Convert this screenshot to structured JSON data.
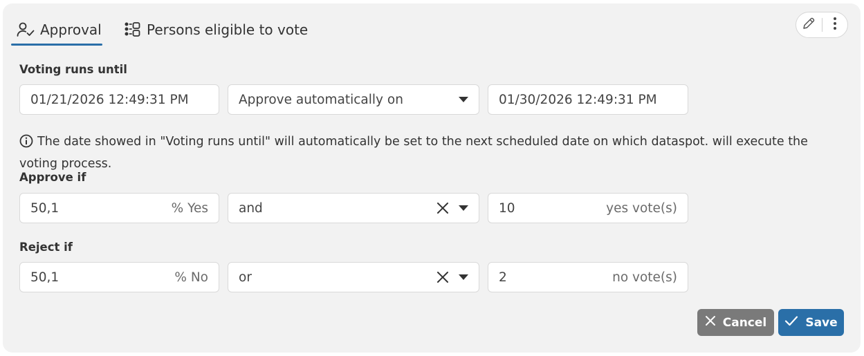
{
  "tabs": {
    "approval_label": "Approval",
    "persons_label": "Persons eligible to vote"
  },
  "voting": {
    "label": "Voting runs until",
    "date_value": "01/21/2026 12:49:31 PM",
    "mode_value": "Approve automatically on",
    "auto_date_value": "01/30/2026 12:49:31 PM"
  },
  "info_text": "The date showed in \"Voting runs until\" will automatically be set to the next scheduled date on which dataspot. will execute the voting process.",
  "approve": {
    "label": "Approve if",
    "percent_value": "50,1",
    "percent_suffix": "% Yes",
    "operator_value": "and",
    "count_value": "10",
    "count_suffix": "yes vote(s)"
  },
  "reject": {
    "label": "Reject if",
    "percent_value": "50,1",
    "percent_suffix": "% No",
    "operator_value": "or",
    "count_value": "2",
    "count_suffix": "no vote(s)"
  },
  "buttons": {
    "cancel_label": "Cancel",
    "save_label": "Save"
  },
  "colors": {
    "accent": "#2a6fa8",
    "cancel": "#7a7a7a",
    "panel": "#f2f2f2"
  },
  "icons": [
    "person-check-icon",
    "list-people-icon",
    "pencil-icon",
    "more-vertical-icon",
    "info-icon",
    "close-icon",
    "caret-down-icon",
    "check-icon"
  ]
}
